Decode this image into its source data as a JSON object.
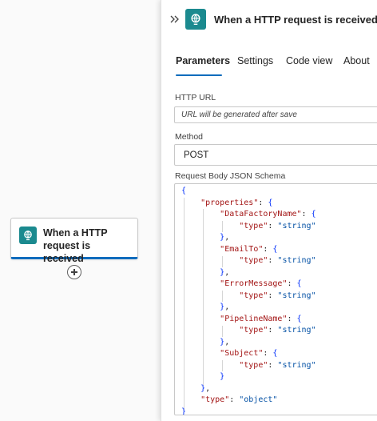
{
  "canvas": {
    "trigger_card": {
      "label": "When a HTTP request is received",
      "icon": "http-request-icon"
    },
    "add_button": {
      "icon": "add-circle-icon"
    }
  },
  "panel": {
    "title": "When a HTTP request is received",
    "icon": "http-request-icon",
    "tabs": [
      {
        "label": "Parameters",
        "active": true
      },
      {
        "label": "Settings",
        "active": false
      },
      {
        "label": "Code view",
        "active": false
      },
      {
        "label": "About",
        "active": false
      }
    ],
    "http_url": {
      "label": "HTTP URL",
      "placeholder": "URL will be generated after save"
    },
    "method": {
      "label": "Method",
      "value": "POST"
    },
    "schema": {
      "label": "Request Body JSON Schema",
      "lines": [
        {
          "indent": 0,
          "tokens": [
            [
              "br",
              "{"
            ]
          ]
        },
        {
          "indent": 2,
          "tokens": [
            [
              "k",
              "\"properties\""
            ],
            [
              "p",
              ": "
            ],
            [
              "br",
              "{"
            ]
          ]
        },
        {
          "indent": 4,
          "tokens": [
            [
              "k",
              "\"DataFactoryName\""
            ],
            [
              "p",
              ": "
            ],
            [
              "br",
              "{"
            ]
          ]
        },
        {
          "indent": 6,
          "tokens": [
            [
              "k",
              "\"type\""
            ],
            [
              "p",
              ": "
            ],
            [
              "s",
              "\"string\""
            ]
          ]
        },
        {
          "indent": 4,
          "tokens": [
            [
              "br",
              "}"
            ],
            [
              "p",
              ","
            ]
          ]
        },
        {
          "indent": 4,
          "tokens": [
            [
              "k",
              "\"EmailTo\""
            ],
            [
              "p",
              ": "
            ],
            [
              "br",
              "{"
            ]
          ]
        },
        {
          "indent": 6,
          "tokens": [
            [
              "k",
              "\"type\""
            ],
            [
              "p",
              ": "
            ],
            [
              "s",
              "\"string\""
            ]
          ]
        },
        {
          "indent": 4,
          "tokens": [
            [
              "br",
              "}"
            ],
            [
              "p",
              ","
            ]
          ]
        },
        {
          "indent": 4,
          "tokens": [
            [
              "k",
              "\"ErrorMessage\""
            ],
            [
              "p",
              ": "
            ],
            [
              "br",
              "{"
            ]
          ]
        },
        {
          "indent": 6,
          "tokens": [
            [
              "k",
              "\"type\""
            ],
            [
              "p",
              ": "
            ],
            [
              "s",
              "\"string\""
            ]
          ]
        },
        {
          "indent": 4,
          "tokens": [
            [
              "br",
              "}"
            ],
            [
              "p",
              ","
            ]
          ]
        },
        {
          "indent": 4,
          "tokens": [
            [
              "k",
              "\"PipelineName\""
            ],
            [
              "p",
              ": "
            ],
            [
              "br",
              "{"
            ]
          ]
        },
        {
          "indent": 6,
          "tokens": [
            [
              "k",
              "\"type\""
            ],
            [
              "p",
              ": "
            ],
            [
              "s",
              "\"string\""
            ]
          ]
        },
        {
          "indent": 4,
          "tokens": [
            [
              "br",
              "}"
            ],
            [
              "p",
              ","
            ]
          ]
        },
        {
          "indent": 4,
          "tokens": [
            [
              "k",
              "\"Subject\""
            ],
            [
              "p",
              ": "
            ],
            [
              "br",
              "{"
            ]
          ]
        },
        {
          "indent": 6,
          "tokens": [
            [
              "k",
              "\"type\""
            ],
            [
              "p",
              ": "
            ],
            [
              "s",
              "\"string\""
            ]
          ]
        },
        {
          "indent": 4,
          "tokens": [
            [
              "br",
              "}"
            ]
          ]
        },
        {
          "indent": 2,
          "tokens": [
            [
              "br",
              "}"
            ],
            [
              "p",
              ","
            ]
          ]
        },
        {
          "indent": 2,
          "tokens": [
            [
              "k",
              "\"type\""
            ],
            [
              "p",
              ": "
            ],
            [
              "s",
              "\"object\""
            ]
          ]
        },
        {
          "indent": 0,
          "tokens": [
            [
              "br",
              "}"
            ]
          ]
        }
      ]
    }
  },
  "colors": {
    "accent": "#0f6cbd",
    "icon_bg": "#1b8a8f",
    "json_key": "#a31515",
    "json_string": "#0451a5"
  }
}
